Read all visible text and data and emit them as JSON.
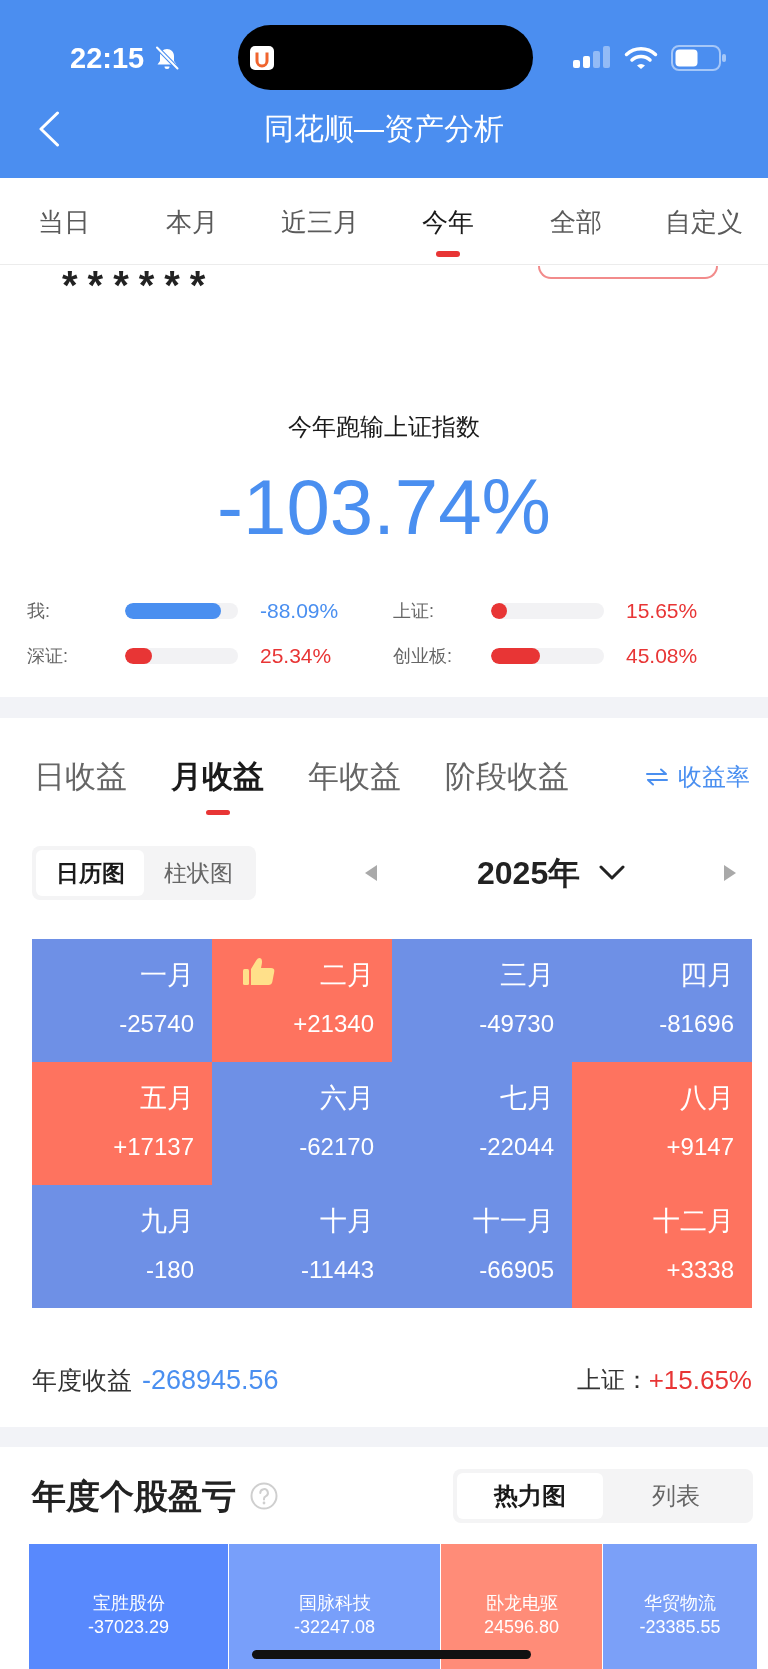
{
  "status_bar": {
    "time": "22:15"
  },
  "nav": {
    "title": "同花顺—资产分析"
  },
  "period_tabs": [
    {
      "label": "当日",
      "selected": false
    },
    {
      "label": "本月",
      "selected": false
    },
    {
      "label": "近三月",
      "selected": false
    },
    {
      "label": "今年",
      "selected": true
    },
    {
      "label": "全部",
      "selected": false
    },
    {
      "label": "自定义",
      "selected": false
    }
  ],
  "summary": {
    "masked_amount": "******",
    "headline": "今年跑输上证指数",
    "difference": "-103.74%"
  },
  "comparison": [
    {
      "label": "我:",
      "level": 0.85,
      "value": "-88.09%",
      "color": "#4a8ff0"
    },
    {
      "label": "上证:",
      "level": 0.14,
      "value": "15.65%",
      "color": "#e83535"
    },
    {
      "label": "深证:",
      "level": 0.24,
      "value": "25.34%",
      "color": "#e83535"
    },
    {
      "label": "创业板:",
      "level": 0.43,
      "value": "45.08%",
      "color": "#e83535"
    }
  ],
  "profit_tabs": [
    {
      "label": "日收益",
      "selected": false
    },
    {
      "label": "月收益",
      "selected": true
    },
    {
      "label": "年收益",
      "selected": false
    },
    {
      "label": "阶段收益",
      "selected": false
    }
  ],
  "rate_toggle": {
    "label": "收益率"
  },
  "view_switch": [
    {
      "label": "日历图",
      "selected": true
    },
    {
      "label": "柱状图",
      "selected": false
    }
  ],
  "year": {
    "label": "2025年"
  },
  "months": [
    {
      "name": "一月",
      "value": "-25740",
      "color": "#6e90e6",
      "thumbs_up": false
    },
    {
      "name": "二月",
      "value": "+21340",
      "color": "#fe735f",
      "thumbs_up": true
    },
    {
      "name": "三月",
      "value": "-49730",
      "color": "#6e90e6",
      "thumbs_up": false
    },
    {
      "name": "四月",
      "value": "-81696",
      "color": "#6e90e6",
      "thumbs_up": false
    },
    {
      "name": "五月",
      "value": "+17137",
      "color": "#fe735f",
      "thumbs_up": false
    },
    {
      "name": "六月",
      "value": "-62170",
      "color": "#6e90e6",
      "thumbs_up": false
    },
    {
      "name": "七月",
      "value": "-22044",
      "color": "#6e90e6",
      "thumbs_up": false
    },
    {
      "name": "八月",
      "value": "+9147",
      "color": "#fe735f",
      "thumbs_up": false
    },
    {
      "name": "九月",
      "value": "-180",
      "color": "#6e90e6",
      "thumbs_up": false
    },
    {
      "name": "十月",
      "value": "-11443",
      "color": "#6e90e6",
      "thumbs_up": false
    },
    {
      "name": "十一月",
      "value": "-66905",
      "color": "#6e90e6",
      "thumbs_up": false
    },
    {
      "name": "十二月",
      "value": "+3338",
      "color": "#fe735f",
      "thumbs_up": false
    }
  ],
  "annual": {
    "label": "年度收益",
    "value": "-268945.56",
    "benchmark_label": "上证：",
    "benchmark_value": "+15.65%"
  },
  "stocks": {
    "title": "年度个股盈亏",
    "view_switch": [
      {
        "label": "热力图",
        "selected": true
      },
      {
        "label": "列表",
        "selected": false
      }
    ],
    "tiles": [
      {
        "name": "宝胜股份",
        "value": "-37023.29",
        "color": "#5889fd"
      },
      {
        "name": "国脉科技",
        "value": "-32247.08",
        "color": "#789ffa"
      },
      {
        "name": "卧龙电驱",
        "value": "24596.80",
        "color": "#ff8c78"
      },
      {
        "name": "华贸物流",
        "value": "-23385.55",
        "color": "#7ba0f8"
      }
    ]
  }
}
